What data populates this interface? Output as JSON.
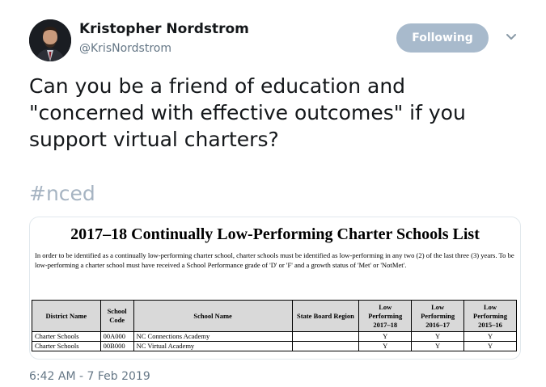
{
  "tweet": {
    "author_name": "Kristopher Nordstrom",
    "author_handle": "@KrisNordstrom",
    "follow_label": "Following",
    "text": "Can you be a friend of education and \"concerned with effective outcomes\" if you support virtual charters?",
    "hashtag": "#nced",
    "timestamp": "6:42 AM - 7 Feb 2019"
  },
  "document": {
    "title": "2017–18 Continually  Low-Performing Charter Schools List",
    "paragraph": "In order to be identified as a continually low-performing charter school, charter schools must be identified as low-performing in any two (2) of the last three (3) years.  To be low-performing a charter school must have received a School Performance grade of 'D' or 'F' and a growth status of 'Met' or 'NotMet'.",
    "columns": [
      "District Name",
      "School Code",
      "School Name",
      "State Board Region",
      "Low Performing 2017–18",
      "Low Performing 2016–17",
      "Low Performing 2015–16"
    ],
    "rows": [
      [
        "Charter Schools",
        "00A000",
        "NC Connections Academy",
        "",
        "Y",
        "Y",
        "Y"
      ],
      [
        "Charter Schools",
        "00B000",
        "NC Virtual Academy",
        "",
        "Y",
        "Y",
        "Y"
      ]
    ]
  },
  "colors": {
    "follow_button": "#a8bacc",
    "hashtag": "#a6b4c2",
    "meta_text": "#657786"
  },
  "icons": {
    "avatar": "avatar-photo",
    "caret": "chevron-down-icon"
  }
}
